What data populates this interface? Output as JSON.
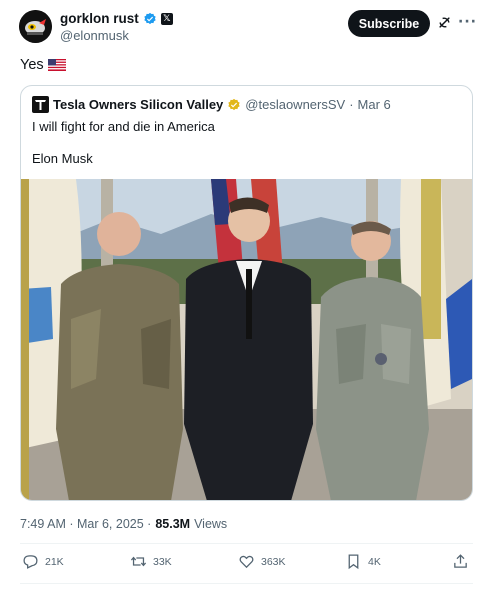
{
  "author": {
    "display_name": "gorklon rust",
    "handle": "@elonmusk",
    "affiliate_badge": "𝕏"
  },
  "header": {
    "subscribe_label": "Subscribe",
    "more_label": "···"
  },
  "tweet": {
    "text": "Yes"
  },
  "quote": {
    "display_name": "Tesla Owners Silicon Valley",
    "handle": "@teslaownersSV",
    "separator": "·",
    "date": "Mar 6",
    "line1": "I will fight for and die in America",
    "line2": "Elon Musk"
  },
  "meta": {
    "time": "7:49 AM · Mar 6, 2025 ·",
    "views_count": "85.3M",
    "views_label": "Views"
  },
  "actions": {
    "replies": "21K",
    "reposts": "33K",
    "likes": "363K",
    "bookmarks": "4K"
  },
  "icons": [
    "verified-icon",
    "grok-icon",
    "more-icon",
    "flag-us-icon",
    "gold-verified-icon",
    "reply-icon",
    "repost-icon",
    "like-icon",
    "bookmark-icon",
    "share-icon"
  ],
  "colors": {
    "verified_blue": "#1d9bf0",
    "verified_gold": "#e2b719",
    "text_primary": "#0f1419",
    "text_secondary": "#536471",
    "subscribe_bg": "#0f1419"
  }
}
